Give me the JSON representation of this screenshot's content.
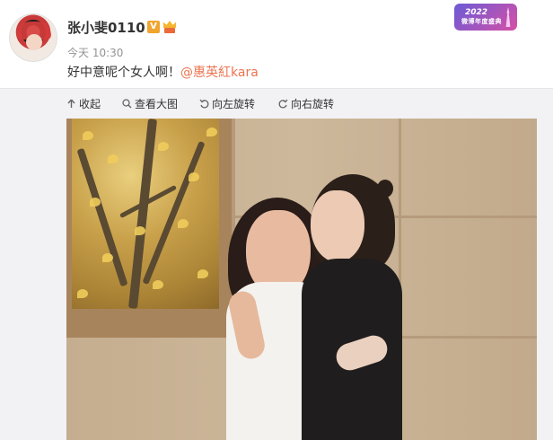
{
  "post": {
    "username": "张小斐0110",
    "vip_badge": "V",
    "timestamp": "今天 10:30",
    "text": "好中意呢个女人啊！",
    "mention": "@惠英紅kara"
  },
  "event_badge": {
    "year": "2022",
    "name": "微博年度盛典"
  },
  "toolbar": {
    "items": [
      {
        "label": "收起",
        "icon": "collapse-up-arrow-icon"
      },
      {
        "label": "查看大图",
        "icon": "zoom-in-icon"
      },
      {
        "label": "向左旋转",
        "icon": "rotate-left-icon"
      },
      {
        "label": "向右旋转",
        "icon": "rotate-right-icon"
      }
    ]
  },
  "colors": {
    "mention": "#eb7350",
    "toolbar_bg": "#f2f2f5",
    "vip_badge": "#f0a530"
  }
}
